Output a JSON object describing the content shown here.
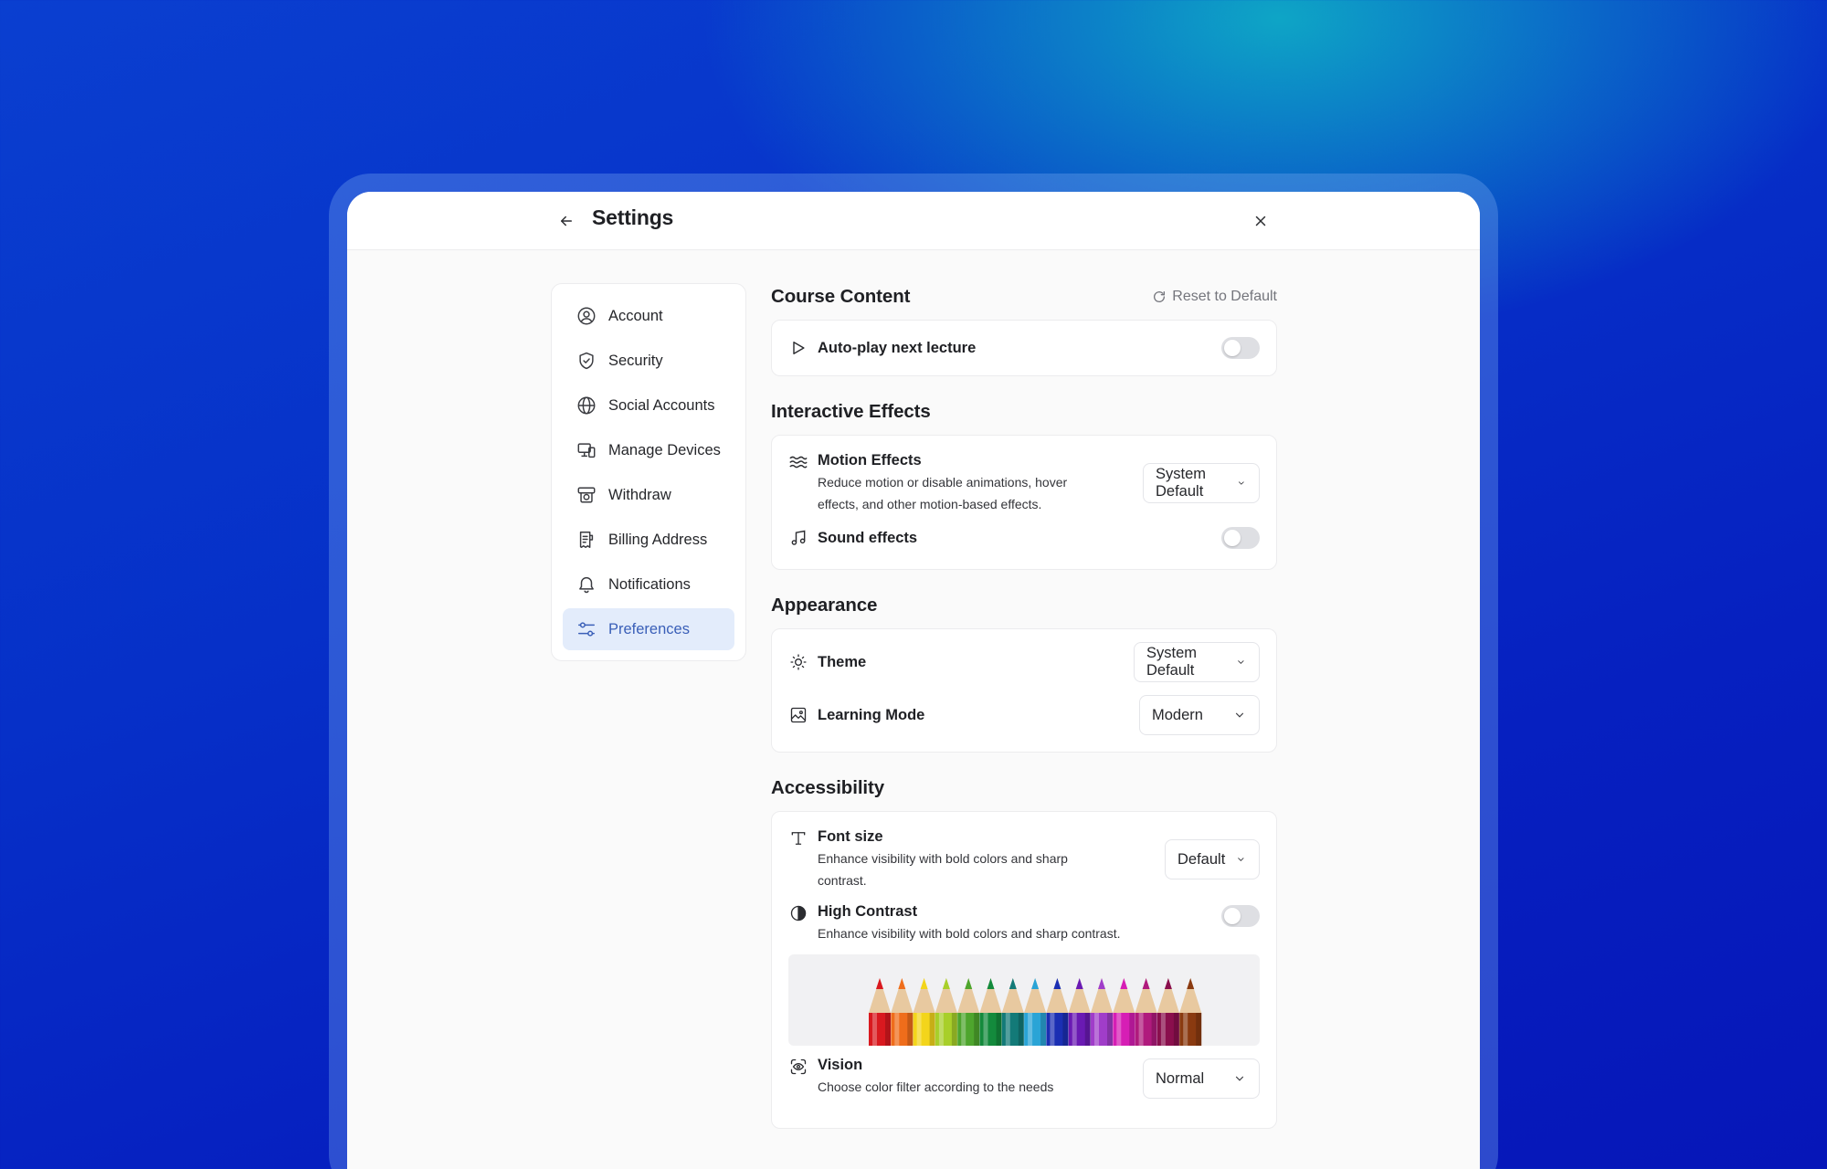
{
  "header": {
    "title": "Settings"
  },
  "sidebar": {
    "items": [
      {
        "label": "Account",
        "icon": "user-circle-icon"
      },
      {
        "label": "Security",
        "icon": "shield-icon"
      },
      {
        "label": "Social Accounts",
        "icon": "globe-icon"
      },
      {
        "label": "Manage Devices",
        "icon": "devices-icon"
      },
      {
        "label": "Withdraw",
        "icon": "withdraw-icon"
      },
      {
        "label": "Billing Address",
        "icon": "receipt-icon"
      },
      {
        "label": "Notifications",
        "icon": "bell-icon"
      },
      {
        "label": "Preferences",
        "icon": "sliders-icon",
        "active": true
      }
    ]
  },
  "sections": {
    "course": {
      "title": "Course Content",
      "reset_label": "Reset to Default",
      "autoplay": {
        "label": "Auto-play next lecture",
        "enabled": false
      }
    },
    "interactive": {
      "title": "Interactive Effects",
      "motion": {
        "label": "Motion Effects",
        "description": "Reduce motion or disable animations, hover effects, and other motion-based effects.",
        "value": "System Default"
      },
      "sound": {
        "label": "Sound effects",
        "enabled": false
      }
    },
    "appearance": {
      "title": "Appearance",
      "theme": {
        "label": "Theme",
        "value": "System Default"
      },
      "learning_mode": {
        "label": "Learning Mode",
        "value": "Modern"
      }
    },
    "accessibility": {
      "title": "Accessibility",
      "font_size": {
        "label": "Font size",
        "description": "Enhance visibility with bold colors and sharp contrast.",
        "value": "Default"
      },
      "high_contrast": {
        "label": "High Contrast",
        "description": "Enhance visibility with bold colors and sharp contrast.",
        "enabled": false
      },
      "vision": {
        "label": "Vision",
        "description": "Choose color filter according to the needs",
        "value": "Normal"
      }
    }
  },
  "colors": {
    "accent": "#3a5fb8",
    "active_bg": "#e3ecfb",
    "toggle_off": "#dedfe3",
    "pencils": [
      "#d9191f",
      "#ef6d1b",
      "#f3d51b",
      "#a8cf2a",
      "#4ea52d",
      "#138a3c",
      "#137a78",
      "#2aa4d6",
      "#1b2fb3",
      "#6a1ab3",
      "#a03dc9",
      "#d61eb5",
      "#b01a7d",
      "#8a0f4d",
      "#8a3a10"
    ]
  }
}
